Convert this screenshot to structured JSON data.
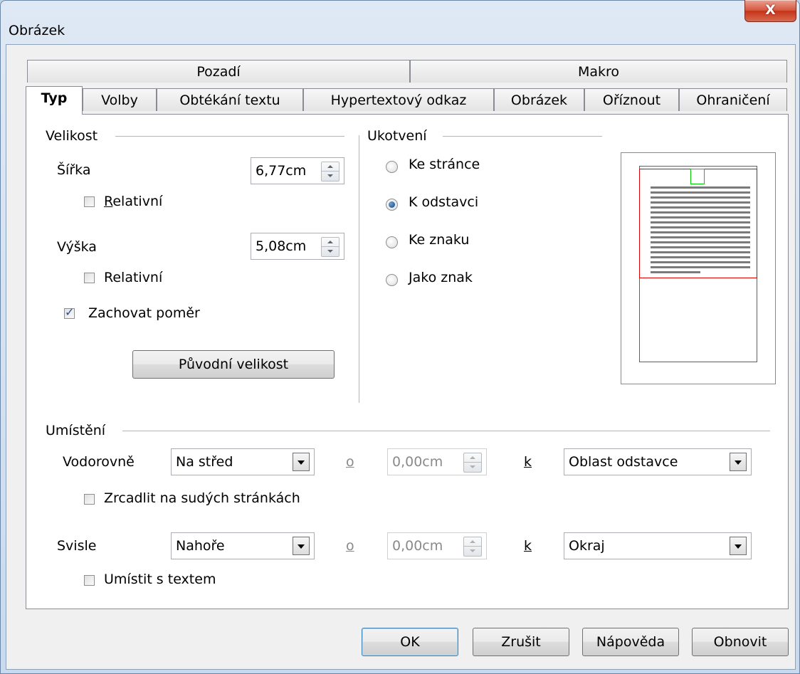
{
  "window": {
    "title": "Obrázek",
    "close_glyph": "X"
  },
  "tabs_row1": [
    {
      "label": "Pozadí"
    },
    {
      "label": "Makro"
    }
  ],
  "tabs_row2": [
    {
      "label": "Typ"
    },
    {
      "label": "Volby"
    },
    {
      "label": "Obtékání textu"
    },
    {
      "label": "Hypertextový odkaz"
    },
    {
      "label": "Obrázek"
    },
    {
      "label": "Oříznout"
    },
    {
      "label": "Ohraničení"
    }
  ],
  "size": {
    "header": "Velikost",
    "width_label": "Šířka",
    "width_value": "6,77cm",
    "relative_width_label": "Relativní",
    "relative_width_checked": false,
    "height_label": "Výška",
    "height_value": "5,08cm",
    "relative_height_label": "Relativní",
    "relative_height_checked": false,
    "keep_ratio_label": "Zachovat poměr",
    "keep_ratio_checked": true,
    "original_size_button": "Původní velikost"
  },
  "anchor": {
    "header": "Ukotvení",
    "options": [
      "Ke stránce",
      "K odstavci",
      "Ke znaku",
      "Jako znak"
    ],
    "selected": "K odstavci"
  },
  "position": {
    "header": "Umístění",
    "horizontal_label": "Vodorovně",
    "horizontal_value": "Na střed",
    "horizontal_by_label": "o",
    "horizontal_by_value": "0,00cm",
    "horizontal_to_label": "k",
    "horizontal_to_value": "Oblast odstavce",
    "mirror_label": "Zrcadlit na sudých stránkách",
    "mirror_checked": false,
    "vertical_label": "Svisle",
    "vertical_value": "Nahoře",
    "vertical_by_label": "o",
    "vertical_by_value": "0,00cm",
    "vertical_to_label": "k",
    "vertical_to_value": "Okraj",
    "follow_text_label": "Umístit s textem",
    "follow_text_checked": false
  },
  "buttons": {
    "ok": "OK",
    "cancel": "Zrušit",
    "help": "Nápověda",
    "reset": "Obnovit"
  },
  "colors": {
    "preview_frame": "#e00000",
    "preview_object": "#00cc00"
  }
}
